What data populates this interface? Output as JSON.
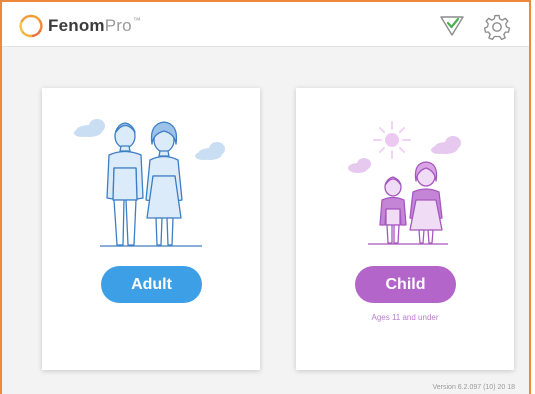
{
  "brand": {
    "name_bold": "Fenom",
    "name_light": "Pro",
    "trademark": "™",
    "accent_color": "#f0883a"
  },
  "header": {
    "status_icon": "checkmark-triangle-icon",
    "settings_icon": "gear-icon",
    "status_color": "#4caf50"
  },
  "cards": [
    {
      "id": "adult",
      "button_label": "Adult",
      "color": "#3d9fe6",
      "subtitle": ""
    },
    {
      "id": "child",
      "button_label": "Child",
      "color": "#b365c9",
      "subtitle": "Ages 11 and under"
    }
  ],
  "footer": {
    "version": "Version 6.2.097 (10) 20 18"
  }
}
